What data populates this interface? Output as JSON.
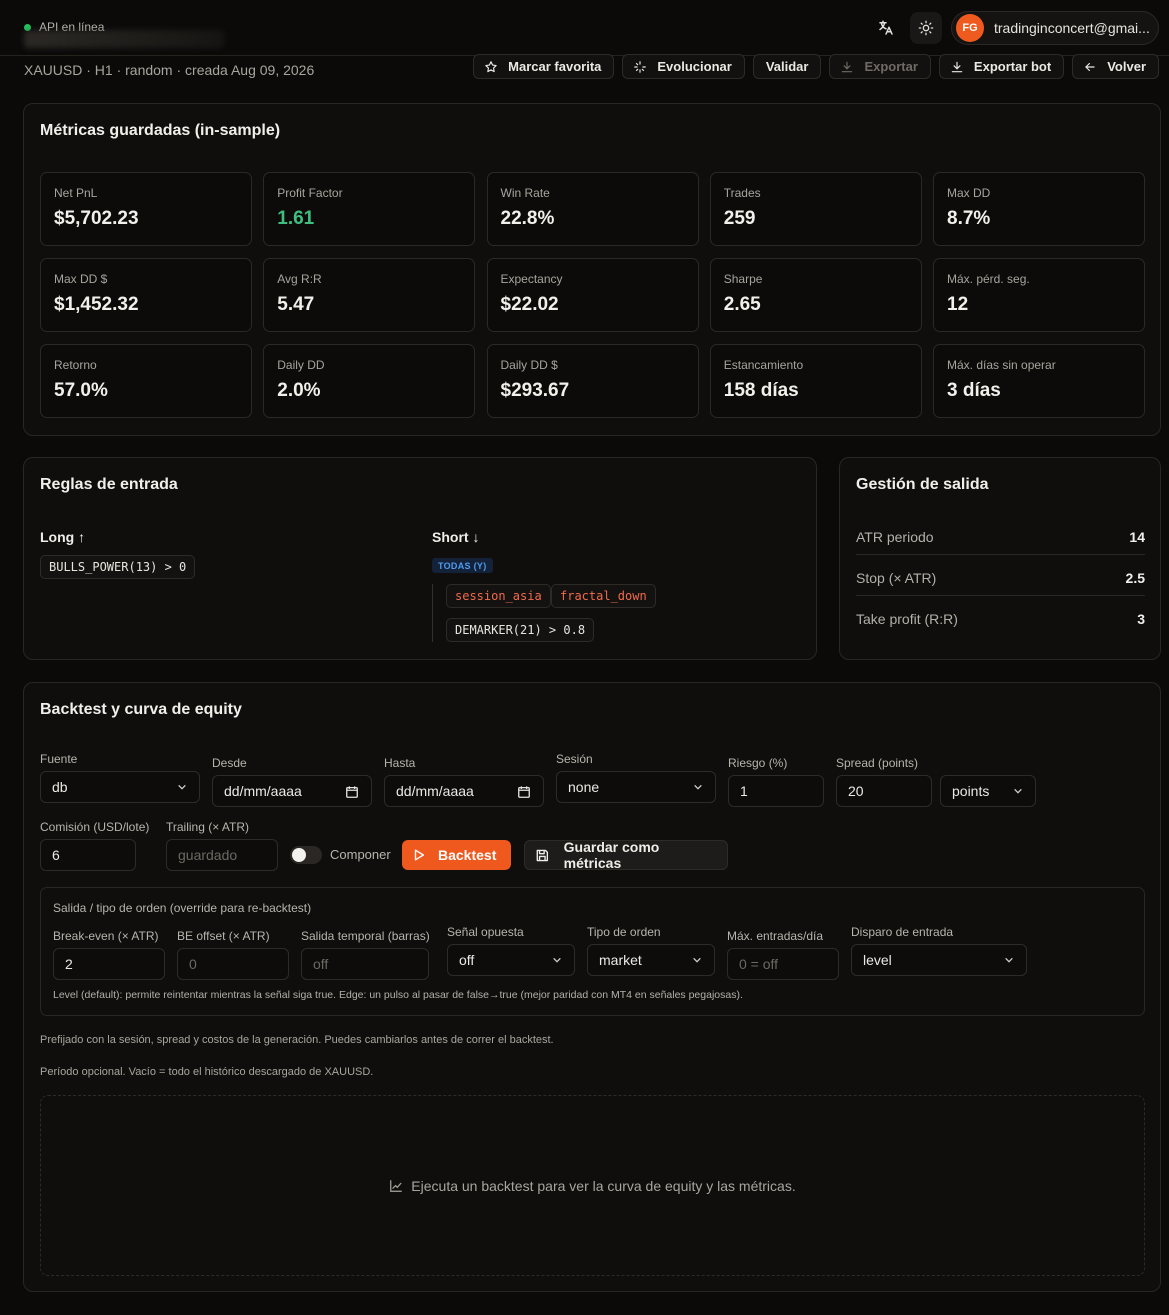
{
  "topbar": {
    "api_status": "API en línea",
    "user_initials": "FG",
    "user_email": "tradinginconcert@gmai..."
  },
  "header": {
    "subtitle": "XAUUSD · H1 · random · creada Aug 09, 2026",
    "actions": [
      {
        "label": "Marcar favorita",
        "icon": "star-icon"
      },
      {
        "label": "Evolucionar",
        "icon": "sparkle-icon"
      },
      {
        "label": "Validar"
      },
      {
        "label": "Exportar",
        "icon": "download-icon",
        "disabled": true
      },
      {
        "label": "Exportar bot",
        "icon": "download-icon"
      },
      {
        "label": "Volver",
        "icon": "arrow-left-icon"
      }
    ]
  },
  "metrics": {
    "title": "Métricas guardadas (in-sample)",
    "items": [
      {
        "label": "Net PnL",
        "value": "$5,702.23"
      },
      {
        "label": "Profit Factor",
        "value": "1.61"
      },
      {
        "label": "Win Rate",
        "value": "22.8%"
      },
      {
        "label": "Trades",
        "value": "259"
      },
      {
        "label": "Max DD",
        "value": "8.7%"
      },
      {
        "label": "Max DD $",
        "value": "$1,452.32"
      },
      {
        "label": "Avg R:R",
        "value": "5.47"
      },
      {
        "label": "Expectancy",
        "value": "$22.02"
      },
      {
        "label": "Sharpe",
        "value": "2.65"
      },
      {
        "label": "Máx. pérd. seg.",
        "value": "12"
      },
      {
        "label": "Retorno",
        "value": "57.0%"
      },
      {
        "label": "Daily DD",
        "value": "2.0%"
      },
      {
        "label": "Daily DD $",
        "value": "$293.67"
      },
      {
        "label": "Estancamiento",
        "value": "158 días"
      },
      {
        "label": "Máx. días sin operar",
        "value": "3 días"
      }
    ],
    "positive_color": "#3fbf7f"
  },
  "entry": {
    "title": "Reglas de entrada",
    "long_label": "Long",
    "long_rule": "BULLS_POWER(13) > 0",
    "short_label": "Short",
    "short_group": "TODAS (Y)",
    "short_rules": [
      "session_asia",
      "fractal_down",
      "DEMARKER(21) > 0.8"
    ]
  },
  "exit": {
    "title": "Gestión de salida",
    "rows": [
      {
        "label": "ATR periodo",
        "value": "14"
      },
      {
        "label": "Stop (× ATR)",
        "value": "2.5"
      },
      {
        "label": "Take profit (R:R)",
        "value": "3"
      }
    ]
  },
  "backtest": {
    "title": "Backtest y curva de equity",
    "fuente": {
      "label": "Fuente",
      "value": "db"
    },
    "desde": {
      "label": "Desde",
      "value": "dd/mm/aaaa"
    },
    "hasta": {
      "label": "Hasta",
      "value": "dd/mm/aaaa"
    },
    "sesion": {
      "label": "Sesión",
      "value": "none"
    },
    "riesgo": {
      "label": "Riesgo (%)",
      "value": "1"
    },
    "spread": {
      "label": "Spread (points)",
      "value": "20",
      "unit": "points"
    },
    "comision": {
      "label": "Comisión (USD/lote)",
      "value": "6"
    },
    "trailing": {
      "label": "Trailing (× ATR)",
      "placeholder": "guardado"
    },
    "componer_label": "Componer",
    "componer_on": false,
    "run_label": "Backtest",
    "save_label": "Guardar como métricas",
    "override": {
      "title": "Salida / tipo de orden (override para re-backtest)",
      "break_even": {
        "label": "Break-even (× ATR)",
        "value": "2"
      },
      "be_offset": {
        "label": "BE offset (× ATR)",
        "placeholder": "0"
      },
      "salida_temporal": {
        "label": "Salida temporal (barras)",
        "placeholder": "off"
      },
      "senal_opuesta": {
        "label": "Señal opuesta",
        "value": "off"
      },
      "tipo_orden": {
        "label": "Tipo de orden",
        "value": "market"
      },
      "max_entradas": {
        "label": "Máx. entradas/día",
        "placeholder": "0 = off"
      },
      "disparo": {
        "label": "Disparo de entrada",
        "value": "level"
      },
      "note": "Level (default): permite reintentar mientras la señal siga true. Edge: un pulso al pasar de false→true (mejor paridad con MT4 en señales pegajosas)."
    },
    "hint1": "Prefijado con la sesión, spread y costos de la generación. Puedes cambiarlos antes de correr el backtest.",
    "hint2": "Período opcional. Vacío = todo el histórico descargado de XAUUSD.",
    "empty_message": "Ejecuta un backtest para ver la curva de equity y las métricas."
  },
  "colors": {
    "accent": "#f0591e",
    "background": "#0b0a09",
    "status_online": "#22c55e",
    "badge_blue": "#4f9bf0",
    "chip_red": "#f26a4a"
  }
}
